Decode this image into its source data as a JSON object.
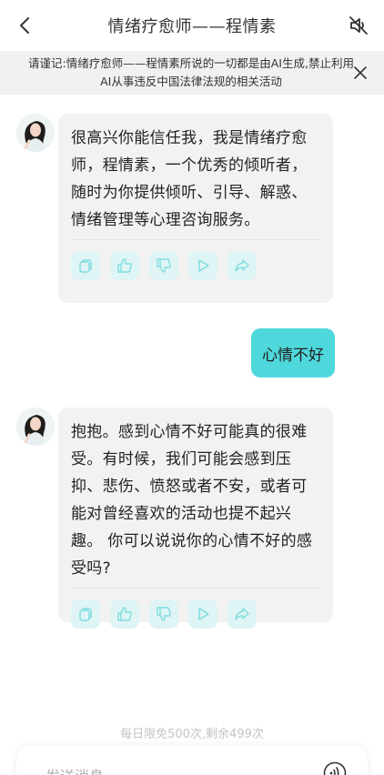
{
  "header": {
    "title": "情绪疗愈师——程情素",
    "back_icon": "chevron-left-icon",
    "mute_icon": "speaker-muted-icon"
  },
  "notice": {
    "text": "请谨记:情绪疗愈师——程情素所说的一切都是由AI生成,禁止利用AI从事违反中国法律法规的相关活动",
    "close_icon": "close-icon"
  },
  "messages": [
    {
      "role": "assistant",
      "text": "很高兴你能信任我，我是情绪疗愈师，程情素，一个优秀的倾听者，随时为你提供倾听、引导、解惑、情绪管理等心理咨询服务。",
      "actions": [
        "copy-icon",
        "thumbs-up-icon",
        "thumbs-down-icon",
        "play-icon",
        "share-icon"
      ]
    },
    {
      "role": "user",
      "text": "心情不好"
    },
    {
      "role": "assistant",
      "text": "抱抱。感到心情不好可能真的很难受。有时候，我们可能会感到压抑、悲伤、愤怒或者不安，或者可能对曾经喜欢的活动也提不起兴趣。 你可以说说你的心情不好的感受吗?",
      "actions": [
        "copy-icon",
        "thumbs-up-icon",
        "thumbs-down-icon",
        "play-icon",
        "share-icon"
      ]
    }
  ],
  "footer": {
    "quota": "每日限免500次,剩余499次",
    "input_placeholder": "发送消息",
    "voice_icon": "voice-input-icon"
  },
  "colors": {
    "accent": "#4fd8dc",
    "action_bg": "#dff4f4",
    "bubble_bg": "#f2f2f2",
    "notice_bg": "#f1f1f1"
  }
}
